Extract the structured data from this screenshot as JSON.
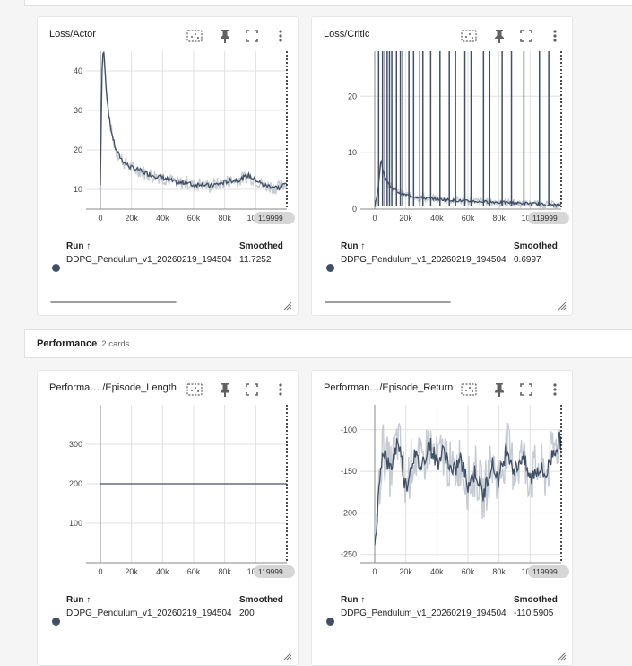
{
  "group": {
    "title": "Performance",
    "count": "2 cards"
  },
  "table_header": {
    "run": "Run",
    "sort_arrow": "↑",
    "smoothed": "Smoothed"
  },
  "cards": [
    {
      "title": "Loss/Actor",
      "run": "DDPG_Pendulum_v1_20260219_194504",
      "smoothed": "11.7252",
      "last_step": "119999"
    },
    {
      "title": "Loss/Critic",
      "run": "DDPG_Pendulum_v1_20260219_194504",
      "smoothed": "0.6997",
      "last_step": "119999"
    },
    {
      "title": "Performa… /Episode_Length",
      "run": "DDPG_Pendulum_v1_20260219_194504",
      "smoothed": "200",
      "last_step": "119999"
    },
    {
      "title": "Performan…/Episode_Return",
      "run": "DDPG_Pendulum_v1_20260219_194504",
      "smoothed": "-110.5905",
      "last_step": "119999"
    }
  ],
  "icons": [
    "fit-domain-icon",
    "pin-icon",
    "fullscreen-icon",
    "more-vert-icon",
    "resize-handle-icon"
  ],
  "colors": {
    "series": "#425066",
    "raw": "#c5cad3",
    "grid": "#e0e0e0"
  },
  "chart_data": [
    {
      "type": "line",
      "x_ticks": [
        "0",
        "20k",
        "40k",
        "60k",
        "80k",
        "100k"
      ],
      "y_ticks": [
        "10",
        "20",
        "30",
        "40"
      ],
      "xlim": [
        0,
        120000
      ],
      "ylim": [
        5,
        45
      ],
      "x": [
        0,
        1000,
        2000,
        4000,
        6000,
        8000,
        10000,
        13000,
        16000,
        20000,
        25000,
        30000,
        35000,
        40000,
        45000,
        50000,
        55000,
        60000,
        65000,
        70000,
        75000,
        80000,
        85000,
        90000,
        95000,
        100000,
        105000,
        110000,
        115000,
        119999
      ],
      "values": [
        11,
        40,
        46,
        34,
        27,
        23,
        20,
        18,
        16.5,
        15.5,
        14.8,
        14,
        13.5,
        13,
        12.3,
        11.5,
        11.8,
        11,
        11.5,
        10.8,
        11.3,
        11.8,
        12.3,
        12.5,
        13.5,
        12.5,
        11,
        10.8,
        10.3,
        11.7
      ]
    },
    {
      "type": "line",
      "x_ticks": [
        "0",
        "20k",
        "40k",
        "60k",
        "80k",
        "100k"
      ],
      "y_ticks": [
        "0",
        "10",
        "20"
      ],
      "xlim": [
        0,
        120000
      ],
      "ylim": [
        0,
        28
      ],
      "x": [
        0,
        2000,
        4000,
        6000,
        10000,
        15000,
        20000,
        30000,
        40000,
        50000,
        60000,
        70000,
        80000,
        90000,
        100000,
        110000,
        119999
      ],
      "values": [
        0.5,
        3,
        9,
        6,
        4,
        3,
        2.5,
        2,
        1.8,
        1.6,
        1.4,
        1.3,
        1.2,
        1.1,
        1,
        0.8,
        0.7
      ],
      "spike_x": [
        2500,
        5000,
        6500,
        8000,
        9500,
        11000,
        14000,
        16500,
        18000,
        22000,
        25000,
        29000,
        31000,
        36000,
        42000,
        48000,
        52000,
        58000,
        62000,
        70000,
        74000,
        82000,
        88000,
        96000,
        106000,
        112000
      ]
    },
    {
      "type": "line",
      "x_ticks": [
        "0",
        "20k",
        "40k",
        "60k",
        "80k",
        "100k"
      ],
      "y_ticks": [
        "100",
        "200",
        "300"
      ],
      "xlim": [
        0,
        120000
      ],
      "ylim": [
        0,
        400
      ],
      "x": [
        0,
        119999
      ],
      "values": [
        200,
        200
      ]
    },
    {
      "type": "line",
      "x_ticks": [
        "0",
        "20k",
        "40k",
        "60k",
        "80k",
        "100k"
      ],
      "y_ticks": [
        "-250",
        "-200",
        "-150",
        "-100"
      ],
      "xlim": [
        0,
        120000
      ],
      "ylim": [
        -260,
        -70
      ],
      "x": [
        0,
        5000,
        10000,
        15000,
        20000,
        25000,
        30000,
        35000,
        40000,
        45000,
        50000,
        55000,
        60000,
        65000,
        70000,
        75000,
        80000,
        85000,
        90000,
        95000,
        100000,
        105000,
        110000,
        115000,
        119999
      ],
      "values": [
        -240,
        -120,
        -150,
        -110,
        -170,
        -130,
        -145,
        -115,
        -140,
        -125,
        -155,
        -135,
        -165,
        -150,
        -180,
        -140,
        -160,
        -120,
        -150,
        -130,
        -160,
        -145,
        -155,
        -125,
        -110.6
      ]
    }
  ]
}
